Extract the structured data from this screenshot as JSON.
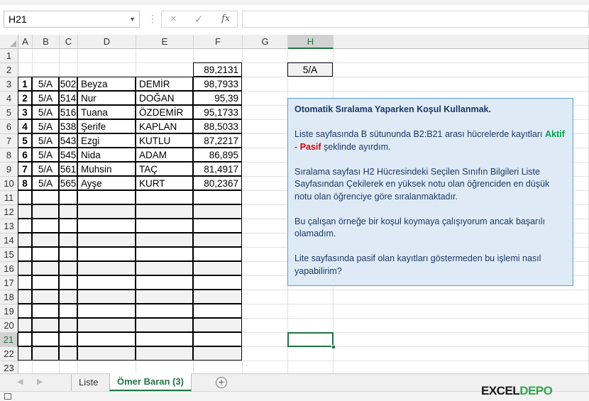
{
  "formula_bar": {
    "name_box": "H21",
    "cancel_icon": "×",
    "enter_icon": "✓",
    "fx_label": "fx",
    "formula": ""
  },
  "columns": [
    "A",
    "B",
    "C",
    "D",
    "E",
    "F",
    "G",
    "H"
  ],
  "rows": [
    {
      "num": "1",
      "a": "",
      "b": "",
      "c": "",
      "d": "",
      "e": "",
      "f": ""
    },
    {
      "num": "2",
      "a": "",
      "b": "",
      "c": "",
      "d": "",
      "e": "",
      "f": "89,2131"
    },
    {
      "num": "3",
      "a": "1",
      "b": "5/A",
      "c": "502",
      "d": "Beyza",
      "e": "DEMİR",
      "f": "98,7933"
    },
    {
      "num": "4",
      "a": "2",
      "b": "5/A",
      "c": "514",
      "d": "Nur",
      "e": "DOĞAN",
      "f": "95,39"
    },
    {
      "num": "5",
      "a": "3",
      "b": "5/A",
      "c": "516",
      "d": "Tuana",
      "e": "ÖZDEMİR",
      "f": "95,1733"
    },
    {
      "num": "6",
      "a": "4",
      "b": "5/A",
      "c": "538",
      "d": "Şerife",
      "e": "KAPLAN",
      "f": "88,5033"
    },
    {
      "num": "7",
      "a": "5",
      "b": "5/A",
      "c": "543",
      "d": "Ezgi",
      "e": "KUTLU",
      "f": "87,2217"
    },
    {
      "num": "8",
      "a": "6",
      "b": "5/A",
      "c": "545",
      "d": "Nida",
      "e": "ADAM",
      "f": "86,895"
    },
    {
      "num": "9",
      "a": "7",
      "b": "5/A",
      "c": "561",
      "d": "Muhsin",
      "e": "TAÇ",
      "f": "81,4917"
    },
    {
      "num": "10",
      "a": "8",
      "b": "5/A",
      "c": "565",
      "d": "Ayşe",
      "e": "KURT",
      "f": "80,2367"
    },
    {
      "num": "11"
    },
    {
      "num": "12"
    },
    {
      "num": "13"
    },
    {
      "num": "14"
    },
    {
      "num": "15"
    },
    {
      "num": "16"
    },
    {
      "num": "17"
    },
    {
      "num": "18"
    },
    {
      "num": "19"
    },
    {
      "num": "20"
    },
    {
      "num": "21"
    },
    {
      "num": "22"
    },
    {
      "num": "23"
    }
  ],
  "h2_value": "5/A",
  "note": {
    "title": "Otomatik Sıralama Yaparken Koşul Kullanmak.",
    "p1_before": "Liste sayfasında B sütununda B2:B21 arası hücrelerde kayıtları ",
    "aktif": "Aktif",
    "dash": " - ",
    "pasif": "Pasif",
    "p1_after": " şeklinde ayırdım.",
    "p2": "Sıralama sayfası H2 Hücresindeki Seçilen Sınıfın Bilgileri Liste Sayfasından Çekilerek en yüksek notu olan öğrenciden en düşük notu olan öğrenciye göre sıralanmaktadır.",
    "p3": "Bu çalışan örneğe bir koşul koymaya çalışıyorum ancak başarılı olamadım.",
    "p4": "Lite sayfasında pasif olan kayıtları göstermeden bu işlemi nasıl yapabilirim?"
  },
  "sheet_tabs": [
    {
      "label": "Liste",
      "active": false
    },
    {
      "label": "Ömer Baran (3)",
      "active": true
    }
  ],
  "add_sheet_icon": "+",
  "watermark": {
    "part1": "EXCEL",
    "part2": "DEPO"
  },
  "colors": {
    "accent": "#217346",
    "note_bg": "#deebf7",
    "note_border": "#5b9bd5",
    "aktif": "#00a050",
    "pasif": "#e00000"
  }
}
